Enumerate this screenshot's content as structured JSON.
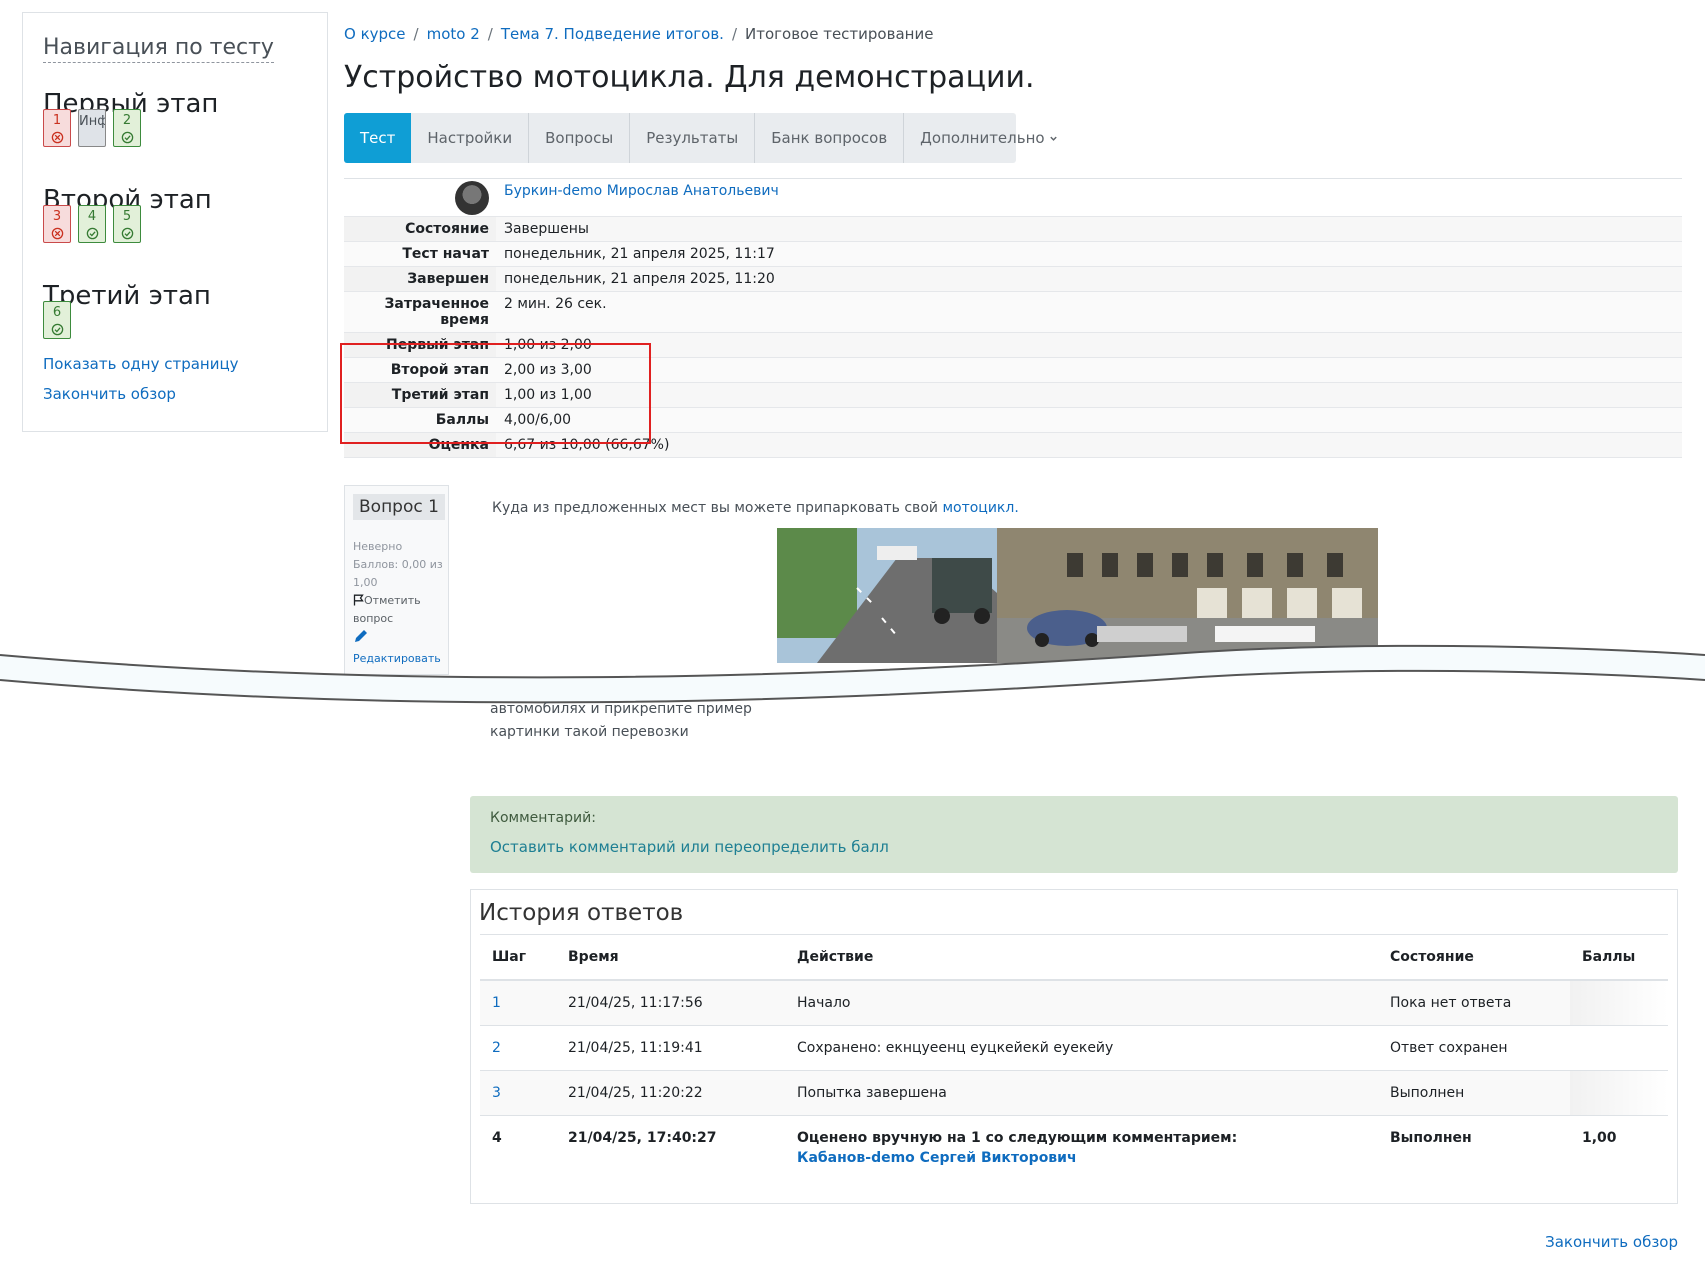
{
  "nav": {
    "title": "Навигация по тесту",
    "stages": [
      {
        "title": "Первый этап"
      },
      {
        "title": "Второй этап"
      },
      {
        "title": "Третий этап"
      }
    ],
    "buttons": {
      "q1": "1",
      "info": "Инф",
      "q2": "2",
      "q3": "3",
      "q4": "4",
      "q5": "5",
      "q6": "6"
    },
    "show_one_page": "Показать одну страницу",
    "finish_review": "Закончить обзор"
  },
  "breadcrumb": [
    "О курсе",
    "moto 2",
    "Тема 7. Подведение итогов.",
    "Итоговое тестирование"
  ],
  "page_title": "Устройство мотоцикла. Для демонстрации.",
  "tabs": [
    "Тест",
    "Настройки",
    "Вопросы",
    "Результаты",
    "Банк вопросов",
    "Дополнительно"
  ],
  "summary": {
    "user_name": "Буркин-demo Мирослав Анатольевич",
    "rows": [
      {
        "label": "Состояние",
        "value": "Завершены"
      },
      {
        "label": "Тест начат",
        "value": "понедельник, 21 апреля 2025, 11:17"
      },
      {
        "label": "Завершен",
        "value": "понедельник, 21 апреля 2025, 11:20"
      },
      {
        "label": "Затраченное время",
        "value": "2 мин. 26 сек."
      },
      {
        "label": "Первый этап",
        "value": "1,00 из 2,00"
      },
      {
        "label": "Второй этап",
        "value": "2,00 из 3,00"
      },
      {
        "label": "Третий этап",
        "value": "1,00 из 1,00"
      },
      {
        "label": "Баллы",
        "value": "4,00/6,00"
      },
      {
        "label": "Оценка",
        "value": "6,67 из 10,00 (66,67%)"
      }
    ]
  },
  "question": {
    "number": "Вопрос 1",
    "status": "Неверно",
    "marks": "Баллов: 0,00 из 1,00",
    "flag": "Отметить вопрос",
    "edit": "Редактировать вопрос",
    "text": "Куда из предложенных мест вы можете припарковать свой",
    "text_link": "мотоцикл.",
    "answer_line1": "автомобилях и прикрепите пример",
    "answer_line2": "картинки такой перевозки"
  },
  "comment": {
    "label": "Комментарий:",
    "link": "Оставить комментарий или переопределить балл"
  },
  "history": {
    "title": "История ответов",
    "headers": [
      "Шаг",
      "Время",
      "Действие",
      "Состояние",
      "Баллы"
    ],
    "rows": [
      {
        "step": "1",
        "time": "21/04/25, 11:17:56",
        "action": "Начало",
        "state": "Пока нет ответа",
        "marks": ""
      },
      {
        "step": "2",
        "time": "21/04/25, 11:19:41",
        "action": "Сохранено: екнцуеенц еуцкейекй еуекейу",
        "state": "Ответ сохранен",
        "marks": ""
      },
      {
        "step": "3",
        "time": "21/04/25, 11:20:22",
        "action": "Попытка завершена",
        "state": "Выполнен",
        "marks": ""
      },
      {
        "step": "4",
        "time": "21/04/25, 17:40:27",
        "action": "Оценено вручную на 1 со следующим комментарием:",
        "grader": "Кабанов-demo Сергей Викторович",
        "state": "Выполнен",
        "marks": "1,00"
      }
    ]
  },
  "finish_review_bottom": "Закончить обзор",
  "colors": {
    "accent": "#0f6cbf",
    "active_tab": "#0f9ed5",
    "incorrect": "#ca3120",
    "correct": "#357a32",
    "highlight_box": "#e02020",
    "comment_bg": "#d5e4d3"
  },
  "icons": [
    "incorrect-icon",
    "correct-icon",
    "flag-icon",
    "pencil-icon",
    "chevron-down-icon",
    "avatar"
  ]
}
